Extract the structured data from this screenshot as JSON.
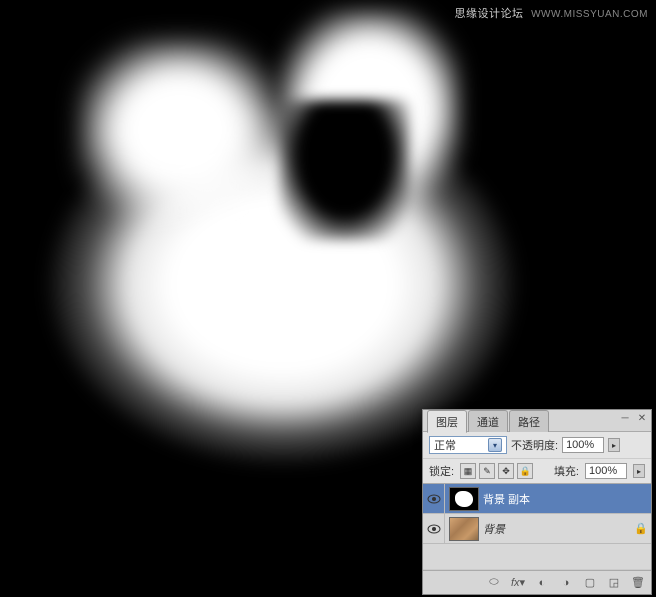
{
  "watermark": {
    "cn": "思缘设计论坛",
    "en": "WWW.MISSYUAN.COM"
  },
  "panel": {
    "tabs": {
      "layers": "图层",
      "channels": "通道",
      "paths": "路径"
    },
    "blend_mode": "正常",
    "opacity_label": "不透明度:",
    "opacity_value": "100%",
    "lock_label": "锁定:",
    "fill_label": "填充:",
    "fill_value": "100%",
    "layers": [
      {
        "name": "背景 副本",
        "selected": true,
        "locked": false,
        "thumb": "mask"
      },
      {
        "name": "背景",
        "selected": false,
        "locked": true,
        "thumb": "photo"
      }
    ]
  }
}
